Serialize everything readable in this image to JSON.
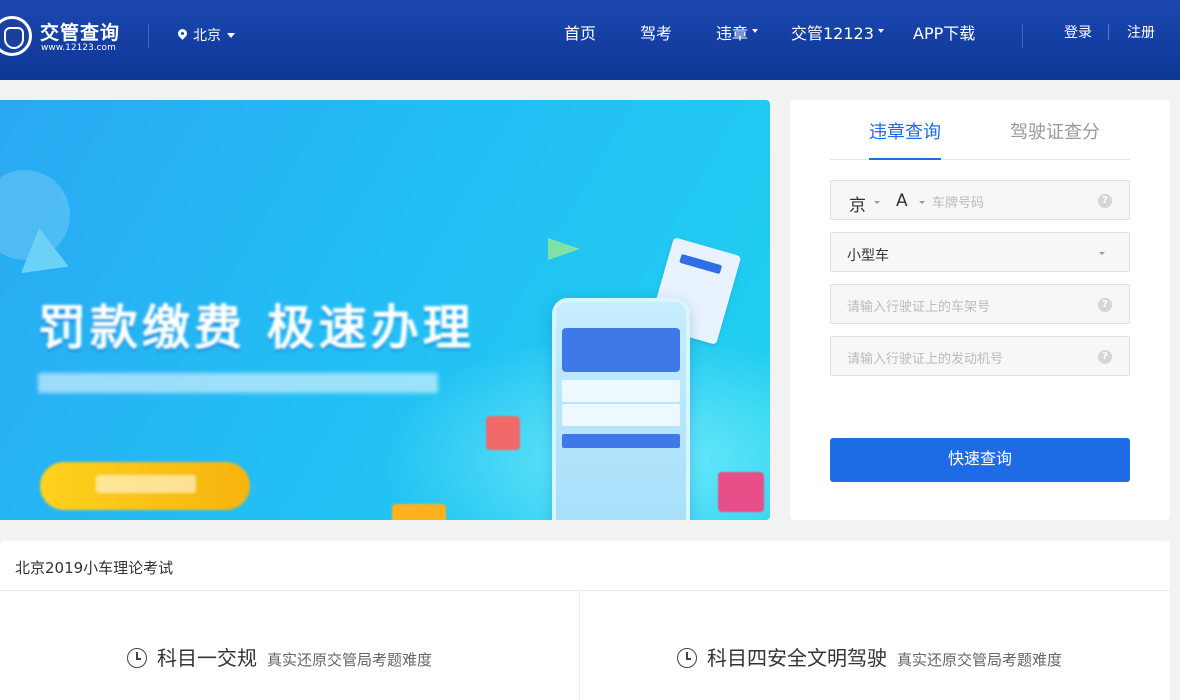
{
  "header": {
    "logo_title": "交管查询",
    "logo_url": "www.12123.com",
    "city": "北京",
    "nav": [
      {
        "label": "首页",
        "has_dropdown": false
      },
      {
        "label": "驾考",
        "has_dropdown": false
      },
      {
        "label": "违章",
        "has_dropdown": true
      },
      {
        "label": "交管12123",
        "has_dropdown": true
      },
      {
        "label": "APP下载",
        "has_dropdown": false
      }
    ],
    "login": "登录",
    "register": "注册"
  },
  "query_panel": {
    "tabs": [
      "违章查询",
      "驾驶证查分"
    ],
    "active_tab": 0,
    "plate_province": "京",
    "plate_letter": "A",
    "plate_placeholder": "车牌号码",
    "vehicle_type": "小型车",
    "vin_placeholder": "请输入行驶证上的车架号",
    "engine_placeholder": "请输入行驶证上的发动机号",
    "submit_label": "快速查询",
    "help_glyph": "?"
  },
  "banner": {
    "title": "罚款缴费  极速办理"
  },
  "exam_section": {
    "title": "北京2019小车理论考试",
    "subjects": [
      {
        "name": "科目一交规",
        "desc": "真实还原交管局考题难度"
      },
      {
        "name": "科目四安全文明驾驶",
        "desc": "真实还原交管局考题难度"
      }
    ]
  },
  "colors": {
    "header_bg": "#1c47b0",
    "accent": "#1e6be6",
    "banner_bg": "#23bdf5",
    "cta_yellow": "#ffd21f"
  }
}
